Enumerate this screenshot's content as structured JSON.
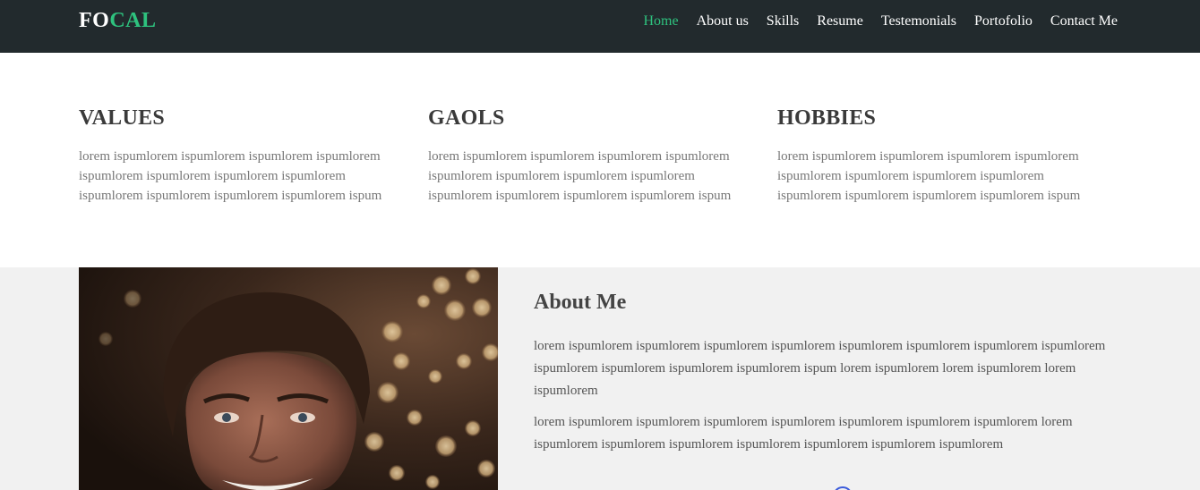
{
  "brand": {
    "logo_part1": "FO",
    "logo_part2": "CAL",
    "accent_color": "#2ec27e"
  },
  "nav": {
    "items": [
      {
        "label": "Home",
        "active": true
      },
      {
        "label": "About us"
      },
      {
        "label": "Skills"
      },
      {
        "label": "Resume"
      },
      {
        "label": "Testemonials"
      },
      {
        "label": "Portofolio"
      },
      {
        "label": "Contact Me"
      }
    ]
  },
  "columns": [
    {
      "title": "VALUES",
      "text": "lorem ispumlorem ispumlorem ispumlorem ispumlorem ispumlorem ispumlorem ispumlorem ispumlorem ispumlorem ispumlorem ispumlorem ispumlorem ispum"
    },
    {
      "title": "GAOLS",
      "text": "lorem ispumlorem ispumlorem ispumlorem ispumlorem ispumlorem ispumlorem ispumlorem ispumlorem ispumlorem ispumlorem ispumlorem ispumlorem ispum"
    },
    {
      "title": "HOBBIES",
      "text": "lorem ispumlorem ispumlorem ispumlorem ispumlorem ispumlorem ispumlorem ispumlorem ispumlorem ispumlorem ispumlorem ispumlorem ispumlorem ispum"
    }
  ],
  "about": {
    "title": "About Me",
    "paragraph1": "lorem ispumlorem ispumlorem ispumlorem ispumlorem ispumlorem ispumlorem ispumlorem ispumlorem ispumlorem ispumlorem ispumlorem ispumlorem ispum lorem ispumlorem lorem ispumlorem lorem ispumlorem",
    "paragraph2": "lorem ispumlorem ispumlorem ispumlorem ispumlorem ispumlorem ispumlorem ispumlorem lorem ispumlorem ispumlorem ispumlorem ispumlorem ispumlorem ispumlorem ispumlorem",
    "photo_icon": "portrait-photo"
  }
}
